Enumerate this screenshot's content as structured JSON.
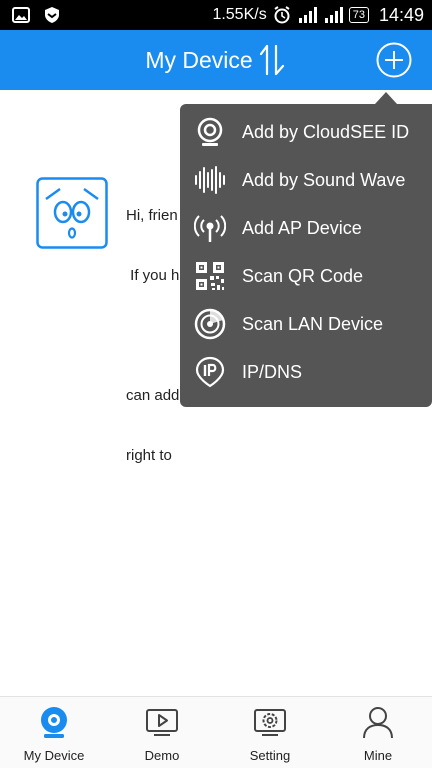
{
  "status_bar": {
    "speed": "1.55K/s",
    "battery": "73",
    "time": "14:49",
    "icons": [
      "image-icon",
      "shield-icon",
      "alarm-icon",
      "signal-icon",
      "signal-icon"
    ]
  },
  "header": {
    "title": "My Device",
    "bg_color": "#1a8cf0"
  },
  "empty_state": {
    "line1": "Hi, frien",
    "line2": " If you h",
    "line3": "can add",
    "line4": "right to"
  },
  "menu": {
    "items": [
      {
        "label": "Add by CloudSEE ID",
        "icon": "webcam-icon"
      },
      {
        "label": "Add by Sound Wave",
        "icon": "sound-wave-icon"
      },
      {
        "label": "Add AP Device",
        "icon": "antenna-icon"
      },
      {
        "label": "Scan QR Code",
        "icon": "qr-code-icon"
      },
      {
        "label": "Scan LAN Device",
        "icon": "radar-icon"
      },
      {
        "label": "IP/DNS",
        "icon": "ip-pin-icon"
      }
    ]
  },
  "bottom_nav": {
    "items": [
      {
        "label": "My Device",
        "icon": "camera-icon",
        "active": true
      },
      {
        "label": "Demo",
        "icon": "play-icon"
      },
      {
        "label": "Setting",
        "icon": "gear-icon"
      },
      {
        "label": "Mine",
        "icon": "person-icon"
      }
    ],
    "active_color": "#1a8cf0"
  }
}
